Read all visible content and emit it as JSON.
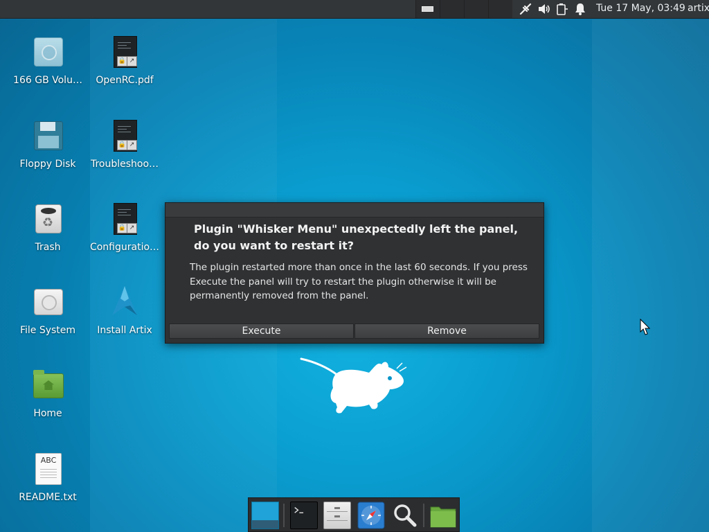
{
  "panel": {
    "clock": "Tue 17 May, 03:49",
    "user": "artix",
    "tray": [
      "network-icon",
      "volume-icon",
      "battery-icon",
      "bell-icon"
    ]
  },
  "desktop": {
    "icons": [
      {
        "label": "166 GB Volu…",
        "icon": "drive-icon"
      },
      {
        "label": "OpenRC.pdf",
        "icon": "document-icon"
      },
      {
        "label": "Floppy Disk",
        "icon": "floppy-icon"
      },
      {
        "label": "Troubleshoo…",
        "icon": "document-icon"
      },
      {
        "label": "Trash",
        "icon": "trash-icon"
      },
      {
        "label": "Configuratio…",
        "icon": "document-icon"
      },
      {
        "label": "File System",
        "icon": "hard-disk-icon"
      },
      {
        "label": "Install Artix",
        "icon": "artix-logo-icon"
      },
      {
        "label": "Home",
        "icon": "home-folder-icon"
      },
      {
        "label": "README.txt",
        "icon": "text-file-icon"
      }
    ]
  },
  "dialog": {
    "heading": "Plugin \"Whisker Menu\" unexpectedly left the panel, do you want to restart it?",
    "body": "The plugin restarted more than once in the last 60 seconds. If you press Execute the panel will try to restart the plugin otherwise it will be permanently removed from the panel.",
    "execute_label": "Execute",
    "remove_label": "Remove"
  },
  "readme_icon_text": "ABC",
  "dock": {
    "items": [
      "desktop-icon",
      "terminal-icon",
      "file-manager-icon",
      "web-browser-icon",
      "search-icon",
      "folder-icon"
    ]
  },
  "colors": {
    "desktop_accent": "#0a9ed0",
    "panel_bg": "#333638",
    "dialog_bg": "#2f3133"
  }
}
